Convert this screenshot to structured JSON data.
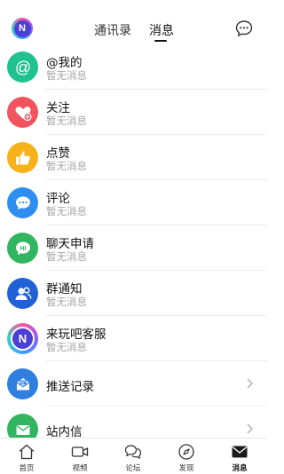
{
  "header": {
    "logo_letter": "N",
    "tabs": [
      {
        "label": "通讯录"
      },
      {
        "label": "消息"
      }
    ]
  },
  "messages": [
    {
      "title": "@我的",
      "subtitle": "暂无消息",
      "icon": "at-icon",
      "color": "#1fc28f"
    },
    {
      "title": "关注",
      "subtitle": "暂无消息",
      "icon": "heart-plus-icon",
      "color": "#f2545f"
    },
    {
      "title": "点赞",
      "subtitle": "暂无消息",
      "icon": "thumbs-up-icon",
      "color": "#f7b219"
    },
    {
      "title": "评论",
      "subtitle": "暂无消息",
      "icon": "comment-bubble-icon",
      "color": "#2f8ff0"
    },
    {
      "title": "聊天申请",
      "subtitle": "暂无消息",
      "icon": "hi-bubble-icon",
      "color": "#31b561"
    },
    {
      "title": "群通知",
      "subtitle": "暂无消息",
      "icon": "group-icon",
      "color": "#2161d6"
    },
    {
      "title": "来玩吧客服",
      "subtitle": "暂无消息",
      "icon": "service-logo-icon",
      "color": "#4b3fd6"
    },
    {
      "title": "推送记录",
      "icon": "push-record-icon",
      "color": "#2f7fe0"
    },
    {
      "title": "站内信",
      "icon": "mail-icon",
      "color": "#31b561"
    }
  ],
  "bottom_nav": [
    {
      "label": "首页",
      "icon": "home-icon"
    },
    {
      "label": "视频",
      "icon": "video-icon"
    },
    {
      "label": "论坛",
      "icon": "forum-icon"
    },
    {
      "label": "发现",
      "icon": "compass-icon"
    },
    {
      "label": "消息",
      "icon": "message-icon",
      "active": true
    }
  ]
}
